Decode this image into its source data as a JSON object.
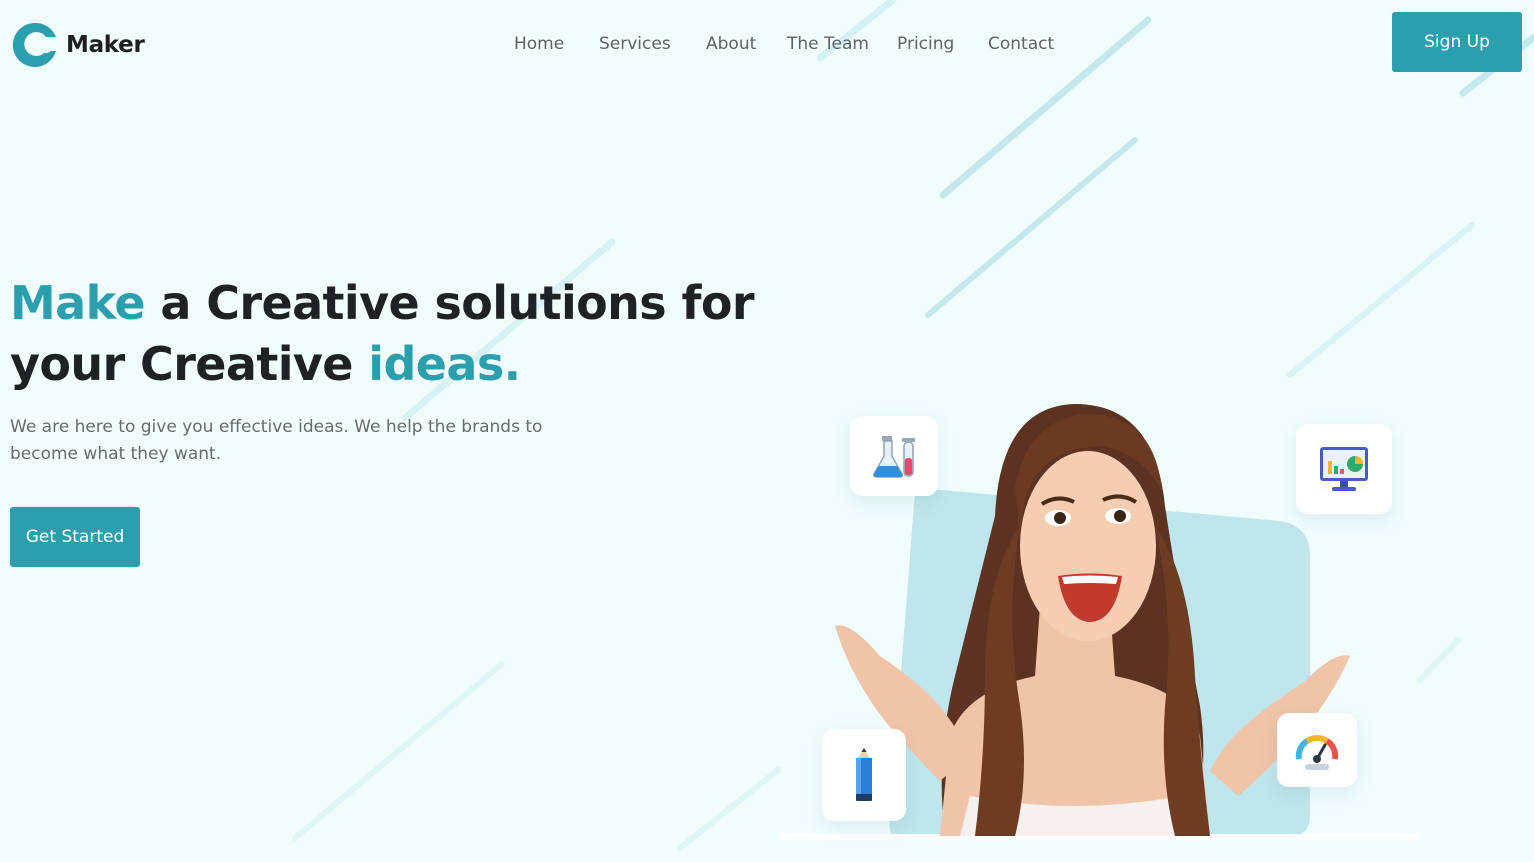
{
  "brand": {
    "name": "Maker",
    "accent_color": "#2b9fae",
    "icon": "maker-logo-icon"
  },
  "nav": {
    "items": [
      {
        "label": "Home"
      },
      {
        "label": "Services"
      },
      {
        "label": "About"
      },
      {
        "label": "The Team"
      },
      {
        "label": "Pricing"
      },
      {
        "label": "Contact"
      }
    ]
  },
  "header": {
    "signup_label": "Sign Up"
  },
  "hero": {
    "headline": {
      "accent_start": "Make",
      "middle": " a Creative solutions for your Creative ",
      "accent_end": "ideas."
    },
    "subtext": "We are here to give you effective ideas. We help the brands to become what they want.",
    "cta_label": "Get Started",
    "image": {
      "subject": "smiling-woman-photo",
      "backdrop_color": "#bfe6ec"
    },
    "floating_icons": [
      "lab-flask-icon",
      "analytics-monitor-icon",
      "pencil-icon",
      "speedometer-icon"
    ]
  }
}
